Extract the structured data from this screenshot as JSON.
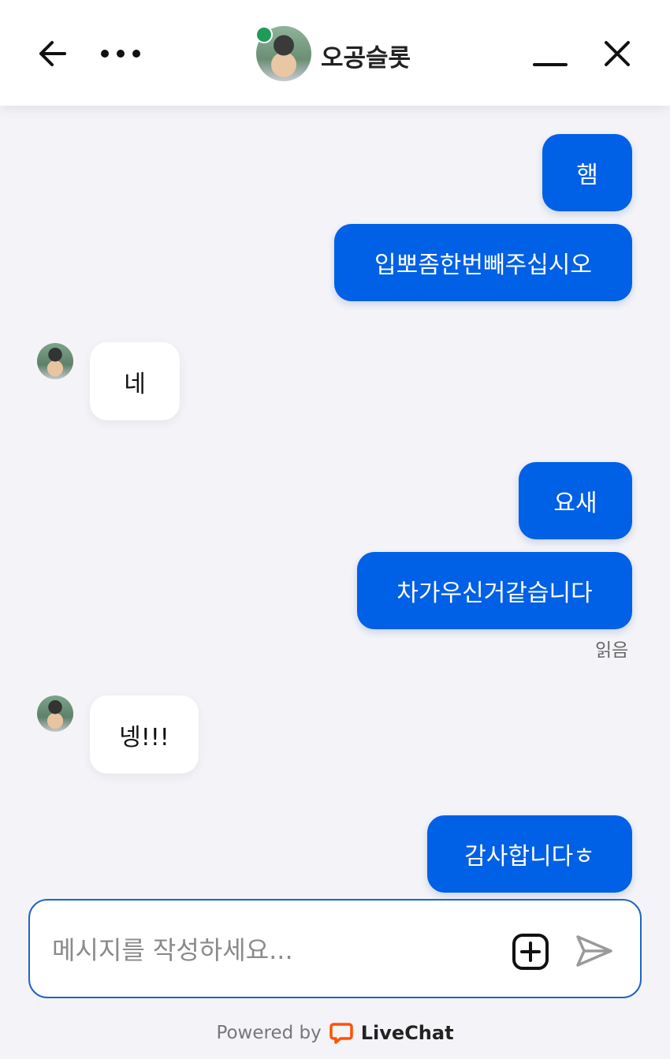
{
  "header": {
    "title": "오공슬롯",
    "online_color": "#1e9c57",
    "icons": [
      "back-arrow-icon",
      "more-dots-icon",
      "minimize-icon",
      "close-icon"
    ]
  },
  "messages": [
    {
      "side": "out",
      "text": "햄"
    },
    {
      "side": "out",
      "text": "입뽀좀한번빼주십시오"
    },
    {
      "side": "in",
      "text": "네"
    },
    {
      "side": "out",
      "text": "요새"
    },
    {
      "side": "out",
      "text": "차가우신거같습니다"
    },
    {
      "side": "in",
      "text": "넹!!!"
    },
    {
      "side": "out",
      "text": "감사합니다ㅎ"
    }
  ],
  "read_receipt": "읽음",
  "composer": {
    "placeholder": "메시지를 작성하세요...",
    "value": ""
  },
  "footer": {
    "powered_by": "Powered by",
    "brand": "LiveChat",
    "brand_color": "#ff5100"
  },
  "colors": {
    "accent": "#0060e6",
    "background": "#f4f4f8"
  }
}
